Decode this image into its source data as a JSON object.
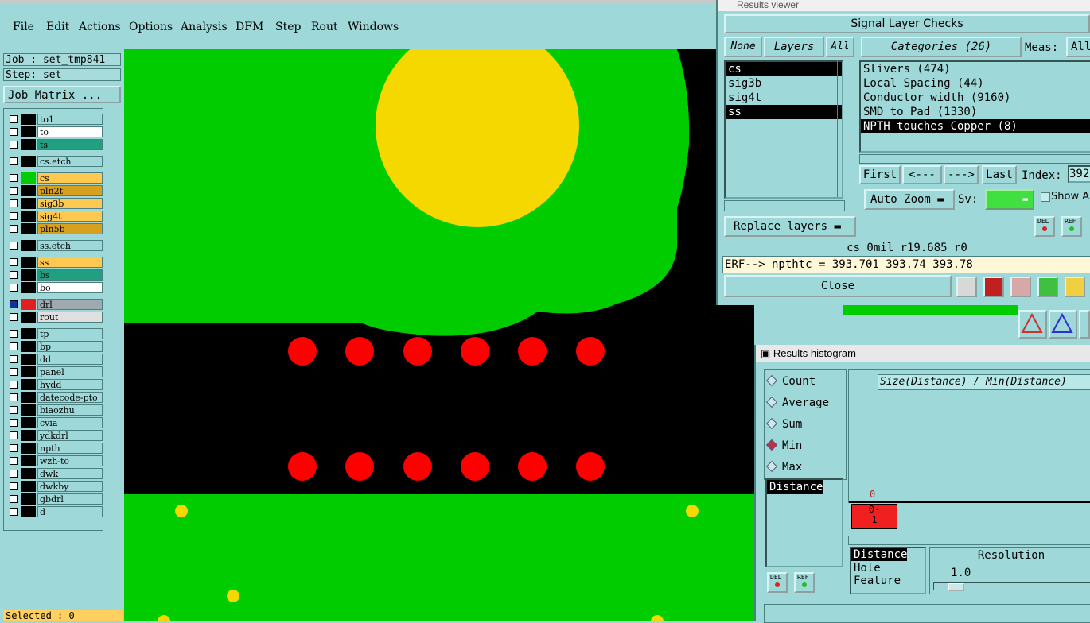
{
  "menubar": {
    "items": [
      "File",
      "Edit",
      "Actions",
      "Options",
      "Analysis",
      "DFM",
      "Step",
      "Rout",
      "Windows"
    ]
  },
  "left": {
    "job": "Job : set_tmp841",
    "step": "Step: set",
    "job_matrix": "Job Matrix ...",
    "selected": "Selected : 0",
    "layers": [
      {
        "name": "to1",
        "color": "#9ed8d8"
      },
      {
        "name": "to",
        "color": "#ffffff"
      },
      {
        "name": "ts",
        "color": "#20a080"
      },
      {
        "name": "cs.etch",
        "color": "#9ed8d8"
      },
      {
        "name": "cs",
        "color": "#ffc850"
      },
      {
        "name": "pln2t",
        "color": "#d8a020"
      },
      {
        "name": "sig3b",
        "color": "#ffc850"
      },
      {
        "name": "sig4t",
        "color": "#ffc850"
      },
      {
        "name": "pln5b",
        "color": "#d8a020"
      },
      {
        "name": "ss.etch",
        "color": "#9ed8d8"
      },
      {
        "name": "ss",
        "color": "#ffc850"
      },
      {
        "name": "bs",
        "color": "#20a080"
      },
      {
        "name": "bo",
        "color": "#ffffff"
      },
      {
        "name": "drl",
        "color": "#a0a8b0"
      },
      {
        "name": "rout",
        "color": "#e0e0e0"
      },
      {
        "name": "tp",
        "color": "#9ed8d8"
      },
      {
        "name": "bp",
        "color": "#9ed8d8"
      },
      {
        "name": "dd",
        "color": "#9ed8d8"
      },
      {
        "name": "panel",
        "color": "#9ed8d8"
      },
      {
        "name": "hydd",
        "color": "#9ed8d8"
      },
      {
        "name": "datecode-pto",
        "color": "#9ed8d8"
      },
      {
        "name": "biaozhu",
        "color": "#9ed8d8"
      },
      {
        "name": "cvia",
        "color": "#9ed8d8"
      },
      {
        "name": "ydkdrl",
        "color": "#9ed8d8"
      },
      {
        "name": "npth",
        "color": "#9ed8d8"
      },
      {
        "name": "wzh-to",
        "color": "#9ed8d8"
      },
      {
        "name": "dwk",
        "color": "#9ed8d8"
      },
      {
        "name": "dwkby",
        "color": "#9ed8d8"
      },
      {
        "name": "gbdrl",
        "color": "#9ed8d8"
      },
      {
        "name": "d",
        "color": "#9ed8d8"
      }
    ]
  },
  "results_viewer": {
    "window_title": "Results viewer",
    "panel_title": "Signal Layer Checks",
    "none_btn": "None",
    "layers_btn": "Layers",
    "all_btn": "All",
    "categories_btn": "Categories (26)",
    "meas_label": "Meas:",
    "meas_value": "All",
    "layers": [
      "cs",
      "sig3b",
      "sig4t",
      "ss"
    ],
    "categories": [
      "Slivers (474)",
      "Local Spacing (44)",
      "Conductor width (9160)",
      "SMD to Pad (1330)",
      "NPTH touches Copper (8)"
    ],
    "first_btn": "First",
    "prev_btn": "<---",
    "next_btn": "--->",
    "last_btn": "Last",
    "index_label": "Index:",
    "index_value": "392",
    "auto_zoom": "Auto Zoom",
    "sv_label": "Sv:",
    "show_label": "Show A",
    "replace_layers": "Replace layers",
    "status": "cs 0mil  r19.685  r0",
    "erf": "ERF--> npthtc = 393.701 393.74 393.78",
    "close": "Close",
    "del_label": "DEL",
    "ref_label": "REF"
  },
  "histogram": {
    "window_title": "Results histogram",
    "modes": [
      "Count",
      "Average",
      "Sum",
      "Min",
      "Max"
    ],
    "selected_mode": "Min",
    "title": "Size(Distance) / Min(Distance)",
    "list_item": "Distance",
    "bar_top_label": "0",
    "bar_label": "0-\n1",
    "sort_items": [
      "Distance",
      "Hole",
      "Feature"
    ],
    "resolution_label": "Resolution",
    "resolution_value": "1.0",
    "del_label": "DEL",
    "ref_label": "REF"
  }
}
